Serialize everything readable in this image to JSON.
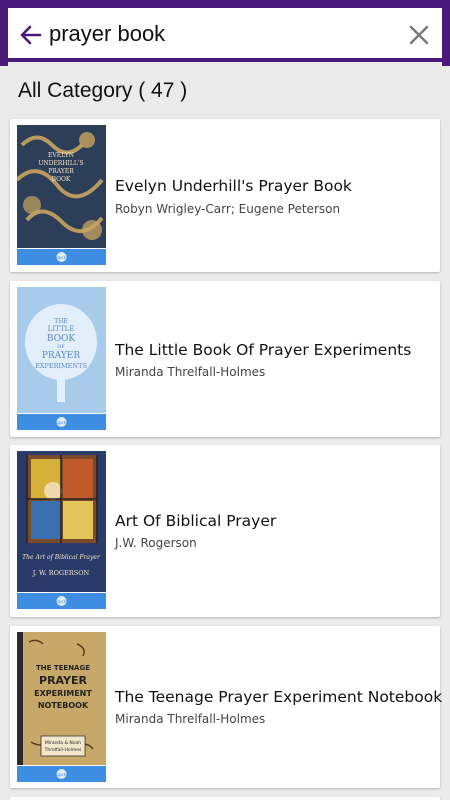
{
  "search": {
    "value": "prayer book",
    "back_icon": "arrow-left-icon",
    "clear_icon": "close-icon"
  },
  "category": {
    "label": "All Category ( 47 )"
  },
  "colors": {
    "frame": "#4a1a7a",
    "badge": "#3d8de2"
  },
  "books": [
    {
      "title": "Evelyn Underhill's Prayer Book",
      "authors": "Robyn Wrigley-Carr;  Eugene Peterson",
      "cover_text": [
        "EVELYN",
        "UNDERHILL'S",
        "PRAYER",
        "BOOK"
      ],
      "badge": "spck"
    },
    {
      "title": "The Little Book Of Prayer Experiments",
      "authors": "Miranda Threlfall-Holmes",
      "cover_text": [
        "THE",
        "LITTLE",
        "BOOK",
        "OF",
        "PRAYER",
        "EXPERIMENTS"
      ],
      "badge": "spck"
    },
    {
      "title": "Art Of Biblical Prayer",
      "authors": "J.W. Rogerson",
      "cover_text": [
        "The Art of Biblical Prayer",
        "J. W. ROGERSON"
      ],
      "badge": "spck"
    },
    {
      "title": "The Teenage Prayer Experiment Notebook",
      "authors": "Miranda Threlfall-Holmes",
      "cover_text": [
        "THE TEENAGE",
        "PRAYER",
        "EXPERIMENT",
        "NOTEBOOK",
        "Miranda & Noah",
        "Threlfall-Holmes"
      ],
      "badge": "spck"
    }
  ]
}
